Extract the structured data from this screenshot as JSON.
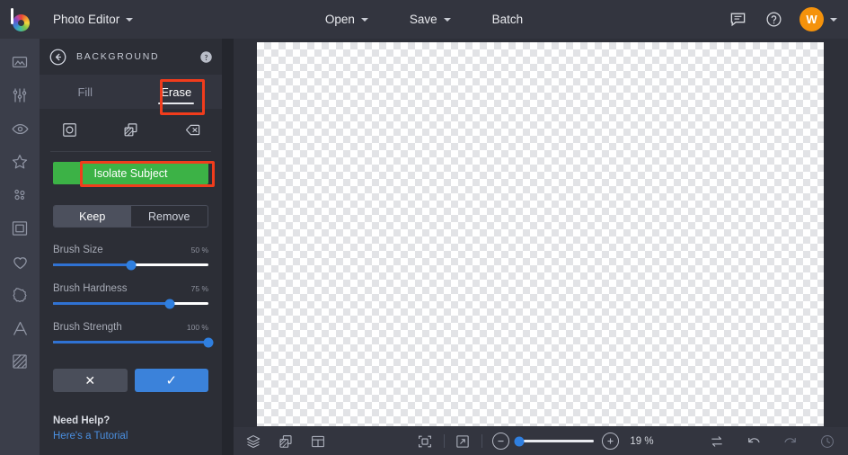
{
  "topbar": {
    "logo_icon": "color-wheel-logo",
    "app_menu_label": "Photo Editor",
    "buttons": [
      {
        "label": "Open",
        "has_caret": true,
        "icon": "chevron-down-icon"
      },
      {
        "label": "Save",
        "has_caret": true,
        "icon": "chevron-down-icon"
      },
      {
        "label": "Batch",
        "has_caret": false,
        "icon": ""
      }
    ],
    "right_icons": [
      "feedback-icon",
      "help-icon"
    ],
    "avatar_initial": "W",
    "avatar_color": "#f5920b"
  },
  "rail": {
    "items": [
      {
        "name": "image-icon",
        "label": "Image"
      },
      {
        "name": "adjust-icon",
        "label": "Adjust"
      },
      {
        "name": "eye-icon",
        "label": "Effects"
      },
      {
        "name": "star-icon",
        "label": "Overlays"
      },
      {
        "name": "particles-icon",
        "label": "Particles"
      },
      {
        "name": "frame-icon",
        "label": "Frames"
      },
      {
        "name": "heart-icon",
        "label": "Elements"
      },
      {
        "name": "badge-icon",
        "label": "Stickers"
      },
      {
        "name": "text-icon",
        "label": "Text"
      },
      {
        "name": "texture-icon",
        "label": "Texture"
      }
    ]
  },
  "panel": {
    "back_icon": "back-arrow-icon",
    "title": "BACKGROUND",
    "help_icon": "help-icon",
    "tabs": [
      {
        "label": "Fill",
        "active": false
      },
      {
        "label": "Erase",
        "active": true
      }
    ],
    "tools": [
      {
        "name": "brush-tool-icon",
        "label": "Brush"
      },
      {
        "name": "transparency-tool-icon",
        "label": "Transparency"
      },
      {
        "name": "eraser-tool-icon",
        "label": "Eraser"
      }
    ],
    "isolate_label": "Isolate Subject",
    "isolate_color": "#3cb246",
    "segments": [
      {
        "label": "Keep",
        "active": true
      },
      {
        "label": "Remove",
        "active": false
      }
    ],
    "sliders": [
      {
        "label": "Brush Size",
        "value": "50 %",
        "pct": 50
      },
      {
        "label": "Brush Hardness",
        "value": "75 %",
        "pct": 75
      },
      {
        "label": "Brush Strength",
        "value": "100 %",
        "pct": 100
      }
    ],
    "actions": [
      {
        "name": "cancel-button",
        "glyph": "✕"
      },
      {
        "name": "confirm-button",
        "glyph": "✓"
      }
    ],
    "need_help_title": "Need Help?",
    "need_help_link": "Here's a Tutorial"
  },
  "annotations": [
    {
      "target": "erase-tab",
      "color": "#f13c1c"
    },
    {
      "target": "isolate-subject-button",
      "color": "#f13c1c"
    }
  ],
  "canvas": {
    "content": "transparent-checkerboard"
  },
  "bottombar": {
    "left_icons": [
      {
        "name": "layers-icon"
      },
      {
        "name": "transparency-icon"
      },
      {
        "name": "layout-icon"
      }
    ],
    "center_icons": [
      {
        "name": "fit-to-screen-icon"
      },
      {
        "name": "fullscreen-icon"
      }
    ],
    "zoom_out_icon": "minus-icon",
    "zoom_in_icon": "plus-icon",
    "zoom_level": "19 %",
    "zoom_slider_pct": 2,
    "right_icons": [
      {
        "name": "compare-icon",
        "dim": false
      },
      {
        "name": "undo-icon",
        "dim": false
      },
      {
        "name": "redo-icon",
        "dim": true
      },
      {
        "name": "history-icon",
        "dim": true
      }
    ]
  }
}
